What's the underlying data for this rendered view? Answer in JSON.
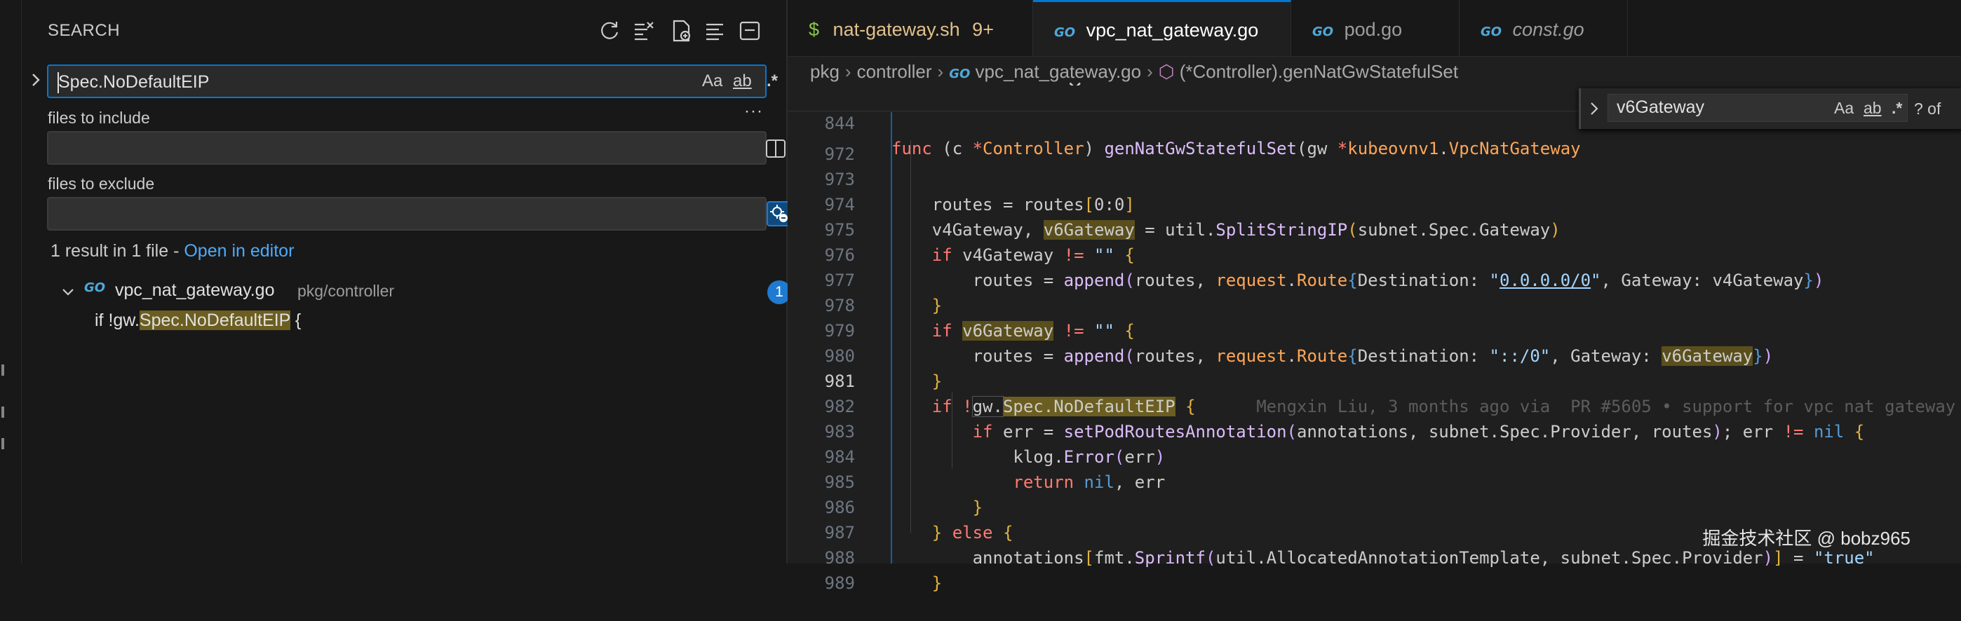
{
  "search_panel": {
    "title": "SEARCH",
    "query": "Spec.NoDefaultEIP",
    "opt_case": "Aa",
    "opt_word": "ab",
    "opt_regex": ".*",
    "more": "···",
    "include_label": "files to include",
    "include_value": "",
    "exclude_label": "files to exclude",
    "exclude_value": "",
    "summary": "1 result in 1 file - ",
    "open_in_editor": "Open in editor",
    "result": {
      "file_badge": "GO",
      "file_name": "vpc_nat_gateway.go",
      "file_path": "pkg/controller",
      "count": "1",
      "match_prefix": "if !gw.",
      "match_hit": "Spec.NoDefaultEIP",
      "match_suffix": " {"
    }
  },
  "tabs": [
    {
      "badge": "$",
      "label": "nat-gateway.sh",
      "extra": "9+",
      "active": false
    },
    {
      "badge": "GO",
      "label": "vpc_nat_gateway.go",
      "extra": "",
      "active": true
    },
    {
      "badge": "GO",
      "label": "pod.go",
      "extra": "",
      "active": false
    },
    {
      "badge": "GO",
      "label": "const.go",
      "extra": "",
      "active": false
    }
  ],
  "tab_close": "✕",
  "breadcrumb": {
    "p1": "pkg",
    "p2": "controller",
    "p3_badge": "GO",
    "p3": "vpc_nat_gateway.go",
    "p4": "(*Controller).genNatGwStatefulSet"
  },
  "find_widget": {
    "query": "v6Gateway",
    "opt_case": "Aa",
    "opt_word": "ab",
    "opt_regex": ".*",
    "count": "? of"
  },
  "line_numbers": {
    "sticky": "844",
    "l972": "972",
    "l973": "973",
    "l974": "974",
    "l975": "975",
    "l976": "976",
    "l977": "977",
    "l978": "978",
    "l979": "979",
    "l980": "980",
    "l981": "981",
    "l982": "982",
    "l983": "983",
    "l984": "984",
    "l985": "985",
    "l986": "986",
    "l987": "987",
    "l988": "988",
    "l989": "989"
  },
  "blame": "Mengxin Liu, 3 months ago via  PR #5605 • support for vpc nat gateway",
  "watermark": "掘金技术社区 @ bobz965",
  "colors": {
    "accent": "#0078d4",
    "link": "#4daafc",
    "match_highlight": "#6b5e20",
    "modified_tab": "#e2c08d"
  }
}
